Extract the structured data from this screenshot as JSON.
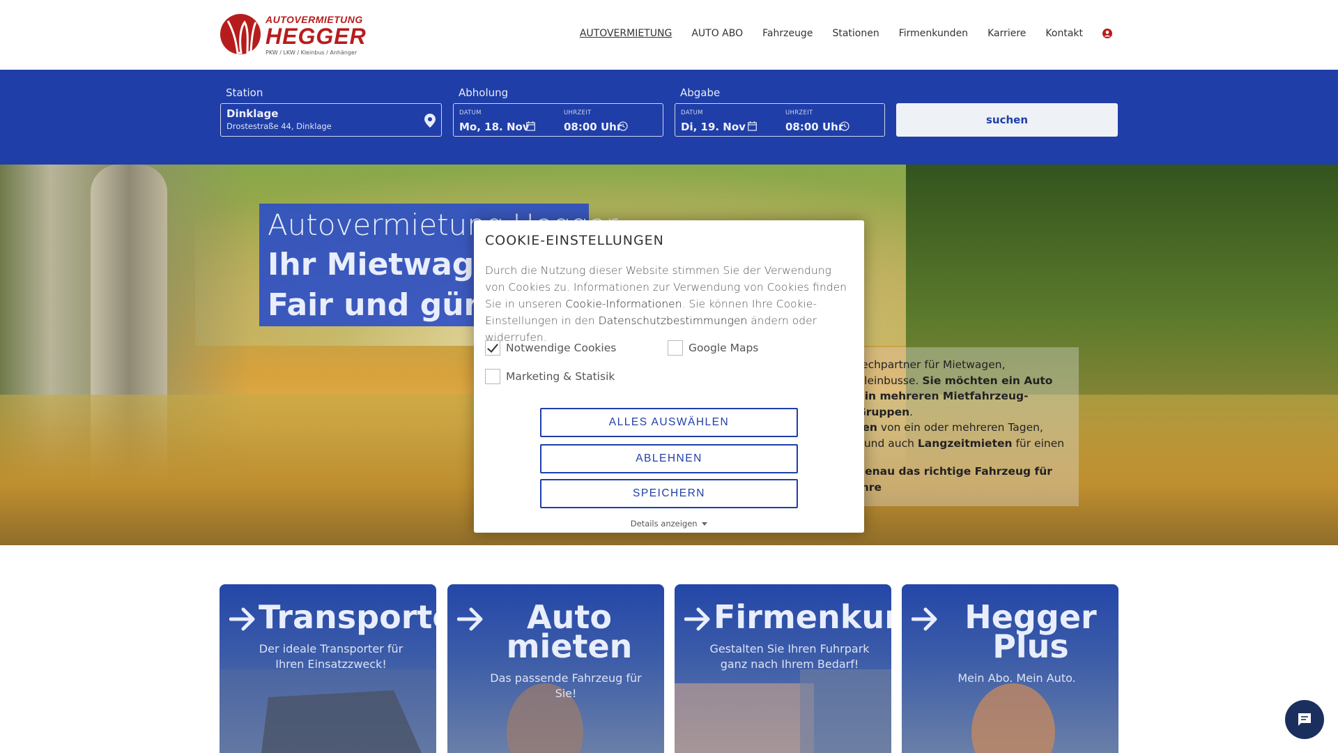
{
  "brand": {
    "line1": "AUTOVERMIETUNG",
    "line2": "HEGGER",
    "tagline": "PKW / LKW / Kleinbus / Anhänger",
    "color": "#b71c1c"
  },
  "nav": {
    "items": [
      {
        "label": "AUTOVERMIETUNG"
      },
      {
        "label": "AUTO ABO"
      },
      {
        "label": "Fahrzeuge"
      },
      {
        "label": "Stationen"
      },
      {
        "label": "Firmenkunden"
      },
      {
        "label": "Karriere"
      },
      {
        "label": "Kontakt"
      }
    ],
    "user_icon": "user-circle-icon"
  },
  "search": {
    "station_label": "Station",
    "station_name": "Dinklage",
    "station_address": "Drostestraße 44, Dinklage",
    "pickup_label": "Abholung",
    "dropoff_label": "Abgabe",
    "date_label": "DATUM",
    "time_label": "UHRZEIT",
    "pickup_date": "Mo, 18. Nov",
    "pickup_time": "08:00 Uhr",
    "dropoff_date": "Di, 19. Nov",
    "dropoff_time": "08:00 Uhr",
    "button": "suchen",
    "bar_color": "#1f3ea8"
  },
  "hero": {
    "title1": "Autovermietung Hegger",
    "title2": "Ihr Mietwagen-",
    "title3": "Fair und günst",
    "text_p1a": "rechpartner für Mietwagen,",
    "text_p1b": "Kleinbusse. ",
    "text_p1b_bold": "Sie möchten ein Auto",
    "text_p1c_bold": "l in mehreren Mietfahrzeug-Gruppen",
    "text_p1c_end": ".",
    "text_p1d_bold": "ten",
    "text_p1d": " von ein oder mehreren Tagen,",
    "text_p1e": ", und auch ",
    "text_p1e_bold": "Langzeitmieten",
    "text_p1e_end": " für einen",
    "text_p2_bold": "genau das richtige Fahrzeug für Ihre"
  },
  "cookie": {
    "title": "COOKIE-EINSTELLUNGEN",
    "desc_1": "Durch die Nutzung dieser Website stimmen Sie der Verwendung von Cookies zu. Informationen zur Verwendung von Cookies finden Sie in unseren ",
    "link_1": "Cookie-Informationen",
    "desc_2": ". Sie können Ihre Cookie-Einstellungen in den ",
    "link_2": "Datenschutzbestimmungen",
    "desc_3": " ändern oder widerrufen.",
    "options": [
      {
        "label": "Notwendige Cookies",
        "checked": true
      },
      {
        "label": "Google Maps",
        "checked": false
      },
      {
        "label": "Marketing & Statisik",
        "checked": false
      }
    ],
    "btn_select_all": "ALLES AUSWÄHLEN",
    "btn_decline": "ABLEHNEN",
    "btn_save": "SPEICHERN",
    "details": "Details anzeigen"
  },
  "cards": [
    {
      "title": "Transporter",
      "sub": "Der ideale Transporter für Ihren Einsatzzweck!"
    },
    {
      "title": "Auto mieten",
      "sub": "Das passende Fahrzeug für Sie!"
    },
    {
      "title": "Firmenkunde",
      "sub": "Gestalten Sie Ihren Fuhrpark ganz nach Ihrem Bedarf!"
    },
    {
      "title": "Hegger Plus",
      "sub": "Mein Abo. Mein Auto."
    }
  ],
  "chat": {
    "icon": "chat-bubble-icon"
  }
}
